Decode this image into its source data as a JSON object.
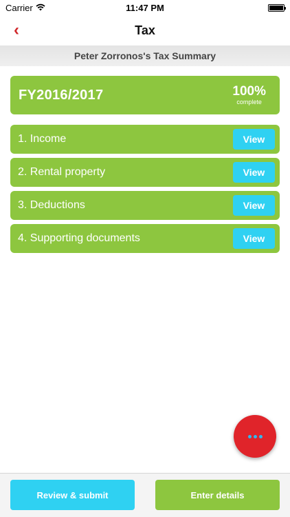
{
  "status_bar": {
    "carrier": "Carrier",
    "time": "11:47 PM",
    "wifi_icon": "wifi-icon",
    "battery_icon": "battery-icon"
  },
  "nav": {
    "title": "Tax",
    "back_icon": "chevron-left-icon",
    "back_glyph": "‹"
  },
  "summary_title": "Peter Zorronos's Tax Summary",
  "financial_year": {
    "label": "FY2016/2017",
    "percent": "100%",
    "status": "complete",
    "progress_fraction": 1.0
  },
  "sections": [
    {
      "label": "1. Income",
      "action": "View"
    },
    {
      "label": "2. Rental property",
      "action": "View"
    },
    {
      "label": "3. Deductions",
      "action": "View"
    },
    {
      "label": "4. Supporting documents",
      "action": "View"
    }
  ],
  "fab": {
    "icon": "more-dots-icon"
  },
  "bottom_buttons": {
    "review_submit": "Review & submit",
    "enter_details": "Enter details"
  },
  "colors": {
    "green": "#8dc63f",
    "cyan": "#2fd1f2",
    "red": "#e0242a",
    "back_red": "#d0282b"
  }
}
